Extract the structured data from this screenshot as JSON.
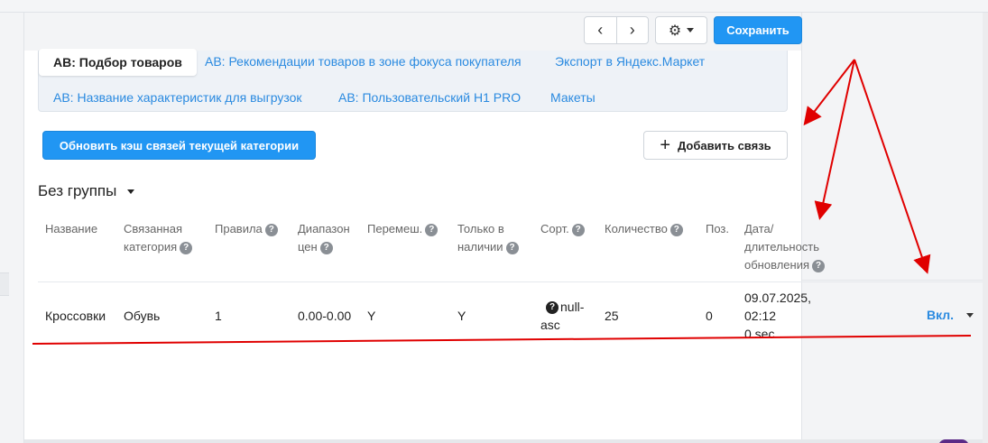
{
  "toolbar": {
    "prev_icon": "‹",
    "next_icon": "›",
    "settings_icon": "⚙",
    "save_label": "Сохранить"
  },
  "tabs": [
    {
      "label": "AB: Подбор товаров",
      "active": true
    },
    {
      "label": "AB: Рекомендации товаров в зоне фокуса покупателя",
      "active": false
    },
    {
      "label": "Экспорт в Яндекс.Маркет",
      "active": false
    },
    {
      "label": "AB: Название характеристик для выгрузок",
      "active": false
    },
    {
      "label": "AB: Пользовательский H1 PRO",
      "active": false
    },
    {
      "label": "Макеты",
      "active": false
    }
  ],
  "actions": {
    "refresh_label": "Обновить кэш связей текущей категории",
    "add_label": "Добавить связь",
    "add_icon": "+"
  },
  "group": {
    "title": "Без группы"
  },
  "table": {
    "headers": {
      "name": "Название",
      "linked_1": "Связанная",
      "linked_2": "категория",
      "rules": "Правила",
      "price_1": "Диапазон",
      "price_2": "цен",
      "shuffle": "Перемеш.",
      "stock_1": "Только в",
      "stock_2": "наличии",
      "sort": "Сорт.",
      "count": "Количество",
      "pos": "Поз.",
      "date_1": "Дата/",
      "date_2": "длительность",
      "date_3": "обновления"
    },
    "help_icon": "?",
    "row": {
      "name": "Кроссовки",
      "linked": "Обувь",
      "rules": "1",
      "price": "0.00-0.00",
      "shuffle": "Y",
      "stock": "Y",
      "sort_1": "null-",
      "sort_2": "asc",
      "count": "25",
      "pos": "0",
      "date_1": "09.07.2025,",
      "date_2": "02:12",
      "date_3": "0 sec",
      "status": "Вкл."
    }
  },
  "colors": {
    "accent": "#2196f3",
    "link": "#2a8ae0",
    "annotation": "#e00000"
  }
}
